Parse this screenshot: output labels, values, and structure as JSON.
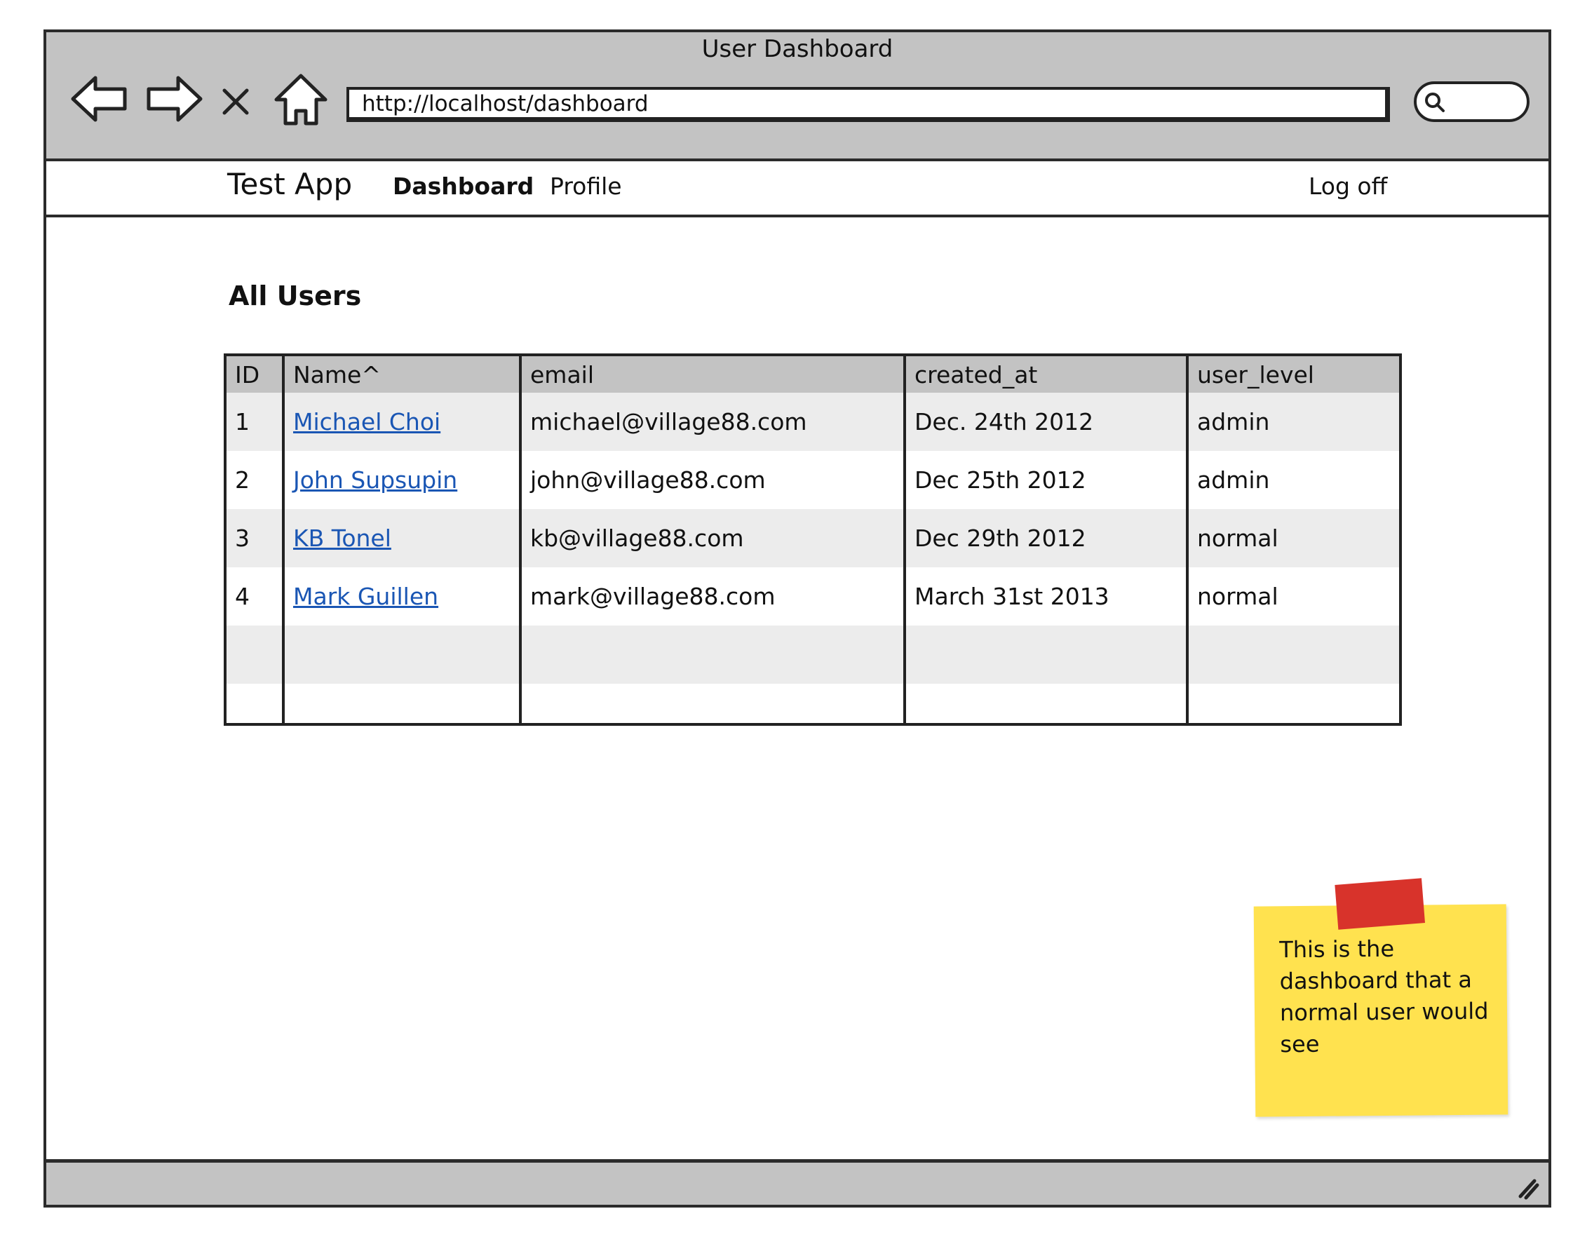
{
  "window": {
    "title": "User Dashboard"
  },
  "toolbar": {
    "back_icon": "back-arrow-icon",
    "forward_icon": "forward-arrow-icon",
    "stop_icon": "close-icon",
    "home_icon": "home-icon",
    "url": "http://localhost/dashboard",
    "search_icon": "search-icon"
  },
  "appnav": {
    "brand": "Test App",
    "links": [
      "Dashboard",
      "Profile"
    ],
    "logoff": "Log off"
  },
  "main": {
    "heading": "All Users",
    "table": {
      "columns": [
        "ID",
        "Name^",
        "email",
        "created_at",
        "user_level"
      ],
      "rows": [
        [
          "1",
          "Michael Choi",
          "michael@village88.com",
          "Dec. 24th 2012",
          "admin"
        ],
        [
          "2",
          "John Supsupin",
          "john@village88.com",
          "Dec 25th 2012",
          "admin"
        ],
        [
          "3",
          "KB Tonel",
          "kb@village88.com",
          "Dec 29th 2012",
          "normal"
        ],
        [
          "4",
          "Mark Guillen",
          "mark@village88.com",
          "March 31st 2013",
          "normal"
        ]
      ]
    }
  },
  "note": {
    "text": "This is the dashboard that a normal user would see"
  },
  "colors": {
    "chrome": "#c3c3c3",
    "link": "#1a56b4",
    "note": "#ffe24f",
    "tape": "#d8332b"
  }
}
